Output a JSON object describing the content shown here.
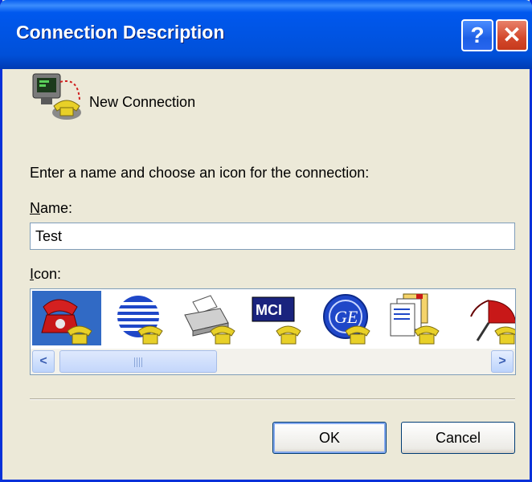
{
  "window": {
    "title": "Connection Description"
  },
  "titlebar": {
    "help_label": "?",
    "close_label": "✕"
  },
  "header": {
    "label": "New Connection"
  },
  "form": {
    "prompt": "Enter a name and choose an icon for the connection:",
    "name_label_accel": "N",
    "name_label_rest": "ame:",
    "name_value": "Test",
    "icon_label_accel": "I",
    "icon_label_rest": "con:"
  },
  "icons": [
    {
      "name": "red-phone-icon",
      "selected": true
    },
    {
      "name": "globe-stripes-icon",
      "selected": false
    },
    {
      "name": "fax-machine-icon",
      "selected": false
    },
    {
      "name": "mci-logo-icon",
      "selected": false
    },
    {
      "name": "ge-logo-icon",
      "selected": false
    },
    {
      "name": "documents-icon",
      "selected": false
    },
    {
      "name": "umbrella-icon",
      "selected": false
    }
  ],
  "scrollbar": {
    "left_arrow": "<",
    "right_arrow": ">"
  },
  "buttons": {
    "ok": "OK",
    "cancel": "Cancel"
  },
  "colors": {
    "titlebar": "#0054e3",
    "dialog_bg": "#ece9d8",
    "selection": "#316ac5"
  }
}
